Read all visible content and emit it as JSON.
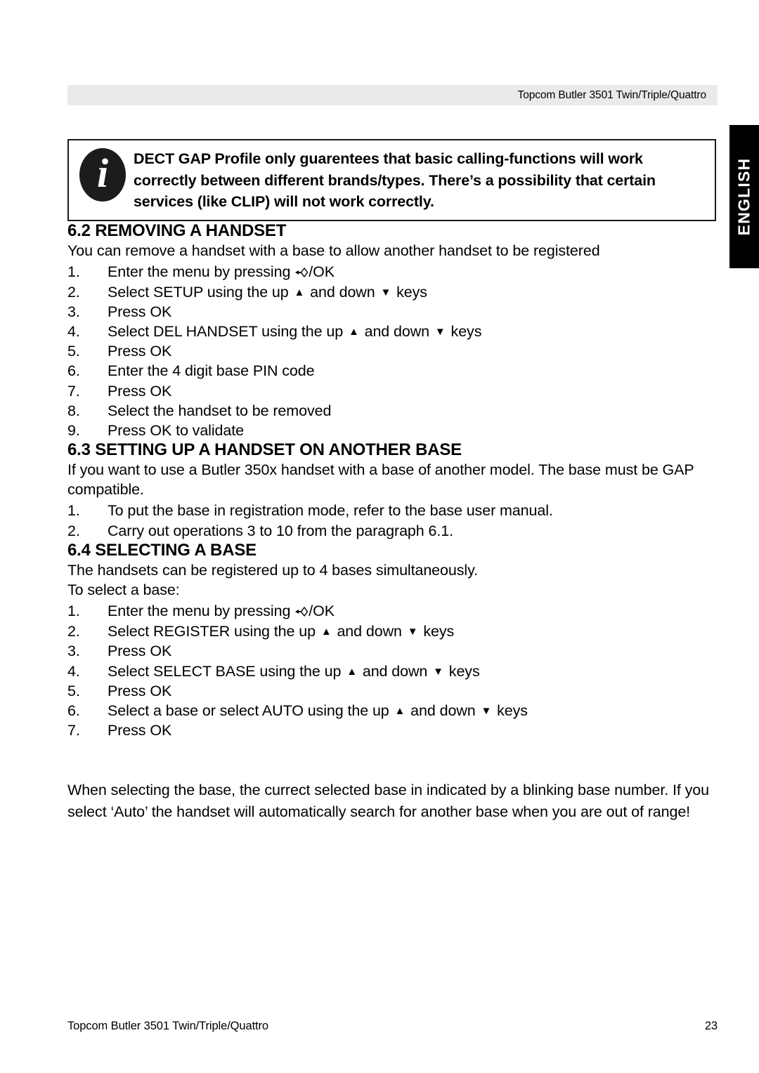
{
  "header": {
    "title": "Topcom Butler 3501 Twin/Triple/Quattro"
  },
  "language_tab": {
    "label": "ENGLISH",
    "background": "#000000",
    "text_color": "#ffffff"
  },
  "note_box": {
    "icon": "info-italic-i-icon",
    "text": "DECT GAP Profile only guarentees that basic calling-functions will work correctly between different brands/types. There’s a possibility  that certain services (like CLIP) will not work correctly."
  },
  "sections": [
    {
      "heading": "6.2 REMOVING A HANDSET",
      "intro": [
        "You can remove a handset with a base to allow another handset to be registered"
      ],
      "steps": [
        {
          "num": "1.",
          "pre": "Enter the menu by pressing ",
          "glyph": "menu-key-icon",
          "post": "/OK"
        },
        {
          "num": "2.",
          "pre": "Select SETUP using the up ",
          "glyph": "up-triangle-icon",
          "mid": " and down ",
          "glyph2": "down-triangle-icon",
          "post": " keys"
        },
        {
          "num": "3.",
          "pre": "Press OK"
        },
        {
          "num": "4.",
          "pre": "Select DEL HANDSET using the up ",
          "glyph": "up-triangle-icon",
          "mid": " and down ",
          "glyph2": "down-triangle-icon",
          "post": " keys"
        },
        {
          "num": "5.",
          "pre": "Press OK"
        },
        {
          "num": "6.",
          "pre": "Enter the 4 digit base PIN code"
        },
        {
          "num": "7.",
          "pre": "Press OK"
        },
        {
          "num": "8.",
          "pre": "Select the handset to be removed"
        },
        {
          "num": "9.",
          "pre": "Press OK to validate"
        }
      ]
    },
    {
      "heading": "6.3 SETTING UP A HANDSET ON ANOTHER BASE",
      "intro": [
        "If you want to use a Butler 350x handset with a base of another model. The base must be GAP compatible."
      ],
      "steps": [
        {
          "num": "1.",
          "pre": "To put the base in registration mode, refer to the base user manual."
        },
        {
          "num": "2.",
          "pre": "Carry out operations 3 to 10 from the paragraph 6.1."
        }
      ]
    },
    {
      "heading": "6.4 SELECTING A BASE",
      "intro": [
        "The handsets can be registered up to 4 bases simultaneously.",
        "To select a base:"
      ],
      "steps": [
        {
          "num": "1.",
          "pre": "Enter the menu by pressing ",
          "glyph": "menu-key-icon",
          "post": "/OK"
        },
        {
          "num": "2.",
          "pre": "Select REGISTER using the up ",
          "glyph": "up-triangle-icon",
          "mid": " and down ",
          "glyph2": "down-triangle-icon",
          "post": " keys"
        },
        {
          "num": "3.",
          "pre": "Press OK"
        },
        {
          "num": "4.",
          "pre": "Select SELECT BASE using the up ",
          "glyph": "up-triangle-icon",
          "mid": " and down ",
          "glyph2": "down-triangle-icon",
          "post": " keys"
        },
        {
          "num": "5.",
          "pre": "Press OK"
        },
        {
          "num": "6.",
          "pre": "Select a base or select AUTO using the up ",
          "glyph": "up-triangle-icon",
          "mid": " and down ",
          "glyph2": "down-triangle-icon",
          "post": " keys"
        },
        {
          "num": "7.",
          "pre": "Press OK"
        }
      ]
    }
  ],
  "closing": {
    "line1": "When selecting the base, the currect selected base in indicated by a blinking base number.",
    "line2": "If you select ‘Auto’ the handset will automatically search for another base when you are out of range!"
  },
  "footer": {
    "left": "Topcom Butler 3501 Twin/Triple/Quattro",
    "page_number": "23"
  }
}
